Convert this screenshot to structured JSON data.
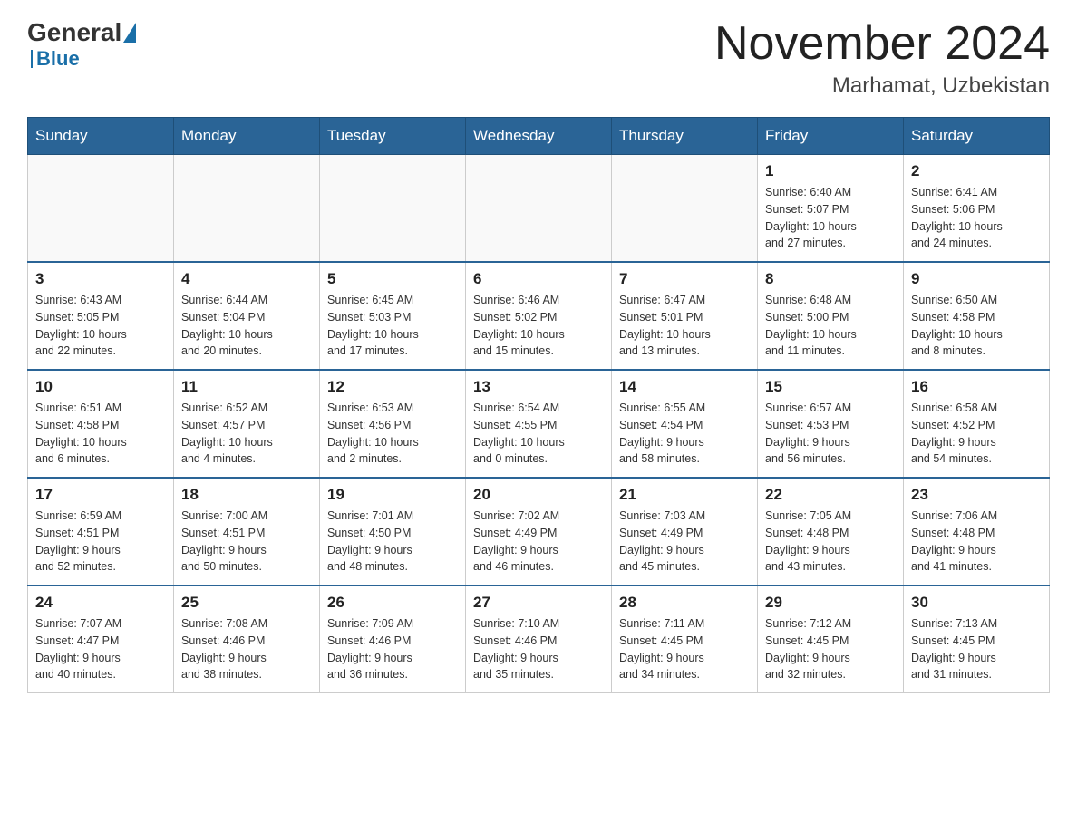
{
  "header": {
    "logo_general": "General",
    "logo_blue": "Blue",
    "month_title": "November 2024",
    "location": "Marhamat, Uzbekistan"
  },
  "weekdays": [
    "Sunday",
    "Monday",
    "Tuesday",
    "Wednesday",
    "Thursday",
    "Friday",
    "Saturday"
  ],
  "weeks": [
    [
      {
        "day": "",
        "info": ""
      },
      {
        "day": "",
        "info": ""
      },
      {
        "day": "",
        "info": ""
      },
      {
        "day": "",
        "info": ""
      },
      {
        "day": "",
        "info": ""
      },
      {
        "day": "1",
        "info": "Sunrise: 6:40 AM\nSunset: 5:07 PM\nDaylight: 10 hours\nand 27 minutes."
      },
      {
        "day": "2",
        "info": "Sunrise: 6:41 AM\nSunset: 5:06 PM\nDaylight: 10 hours\nand 24 minutes."
      }
    ],
    [
      {
        "day": "3",
        "info": "Sunrise: 6:43 AM\nSunset: 5:05 PM\nDaylight: 10 hours\nand 22 minutes."
      },
      {
        "day": "4",
        "info": "Sunrise: 6:44 AM\nSunset: 5:04 PM\nDaylight: 10 hours\nand 20 minutes."
      },
      {
        "day": "5",
        "info": "Sunrise: 6:45 AM\nSunset: 5:03 PM\nDaylight: 10 hours\nand 17 minutes."
      },
      {
        "day": "6",
        "info": "Sunrise: 6:46 AM\nSunset: 5:02 PM\nDaylight: 10 hours\nand 15 minutes."
      },
      {
        "day": "7",
        "info": "Sunrise: 6:47 AM\nSunset: 5:01 PM\nDaylight: 10 hours\nand 13 minutes."
      },
      {
        "day": "8",
        "info": "Sunrise: 6:48 AM\nSunset: 5:00 PM\nDaylight: 10 hours\nand 11 minutes."
      },
      {
        "day": "9",
        "info": "Sunrise: 6:50 AM\nSunset: 4:58 PM\nDaylight: 10 hours\nand 8 minutes."
      }
    ],
    [
      {
        "day": "10",
        "info": "Sunrise: 6:51 AM\nSunset: 4:58 PM\nDaylight: 10 hours\nand 6 minutes."
      },
      {
        "day": "11",
        "info": "Sunrise: 6:52 AM\nSunset: 4:57 PM\nDaylight: 10 hours\nand 4 minutes."
      },
      {
        "day": "12",
        "info": "Sunrise: 6:53 AM\nSunset: 4:56 PM\nDaylight: 10 hours\nand 2 minutes."
      },
      {
        "day": "13",
        "info": "Sunrise: 6:54 AM\nSunset: 4:55 PM\nDaylight: 10 hours\nand 0 minutes."
      },
      {
        "day": "14",
        "info": "Sunrise: 6:55 AM\nSunset: 4:54 PM\nDaylight: 9 hours\nand 58 minutes."
      },
      {
        "day": "15",
        "info": "Sunrise: 6:57 AM\nSunset: 4:53 PM\nDaylight: 9 hours\nand 56 minutes."
      },
      {
        "day": "16",
        "info": "Sunrise: 6:58 AM\nSunset: 4:52 PM\nDaylight: 9 hours\nand 54 minutes."
      }
    ],
    [
      {
        "day": "17",
        "info": "Sunrise: 6:59 AM\nSunset: 4:51 PM\nDaylight: 9 hours\nand 52 minutes."
      },
      {
        "day": "18",
        "info": "Sunrise: 7:00 AM\nSunset: 4:51 PM\nDaylight: 9 hours\nand 50 minutes."
      },
      {
        "day": "19",
        "info": "Sunrise: 7:01 AM\nSunset: 4:50 PM\nDaylight: 9 hours\nand 48 minutes."
      },
      {
        "day": "20",
        "info": "Sunrise: 7:02 AM\nSunset: 4:49 PM\nDaylight: 9 hours\nand 46 minutes."
      },
      {
        "day": "21",
        "info": "Sunrise: 7:03 AM\nSunset: 4:49 PM\nDaylight: 9 hours\nand 45 minutes."
      },
      {
        "day": "22",
        "info": "Sunrise: 7:05 AM\nSunset: 4:48 PM\nDaylight: 9 hours\nand 43 minutes."
      },
      {
        "day": "23",
        "info": "Sunrise: 7:06 AM\nSunset: 4:48 PM\nDaylight: 9 hours\nand 41 minutes."
      }
    ],
    [
      {
        "day": "24",
        "info": "Sunrise: 7:07 AM\nSunset: 4:47 PM\nDaylight: 9 hours\nand 40 minutes."
      },
      {
        "day": "25",
        "info": "Sunrise: 7:08 AM\nSunset: 4:46 PM\nDaylight: 9 hours\nand 38 minutes."
      },
      {
        "day": "26",
        "info": "Sunrise: 7:09 AM\nSunset: 4:46 PM\nDaylight: 9 hours\nand 36 minutes."
      },
      {
        "day": "27",
        "info": "Sunrise: 7:10 AM\nSunset: 4:46 PM\nDaylight: 9 hours\nand 35 minutes."
      },
      {
        "day": "28",
        "info": "Sunrise: 7:11 AM\nSunset: 4:45 PM\nDaylight: 9 hours\nand 34 minutes."
      },
      {
        "day": "29",
        "info": "Sunrise: 7:12 AM\nSunset: 4:45 PM\nDaylight: 9 hours\nand 32 minutes."
      },
      {
        "day": "30",
        "info": "Sunrise: 7:13 AM\nSunset: 4:45 PM\nDaylight: 9 hours\nand 31 minutes."
      }
    ]
  ]
}
